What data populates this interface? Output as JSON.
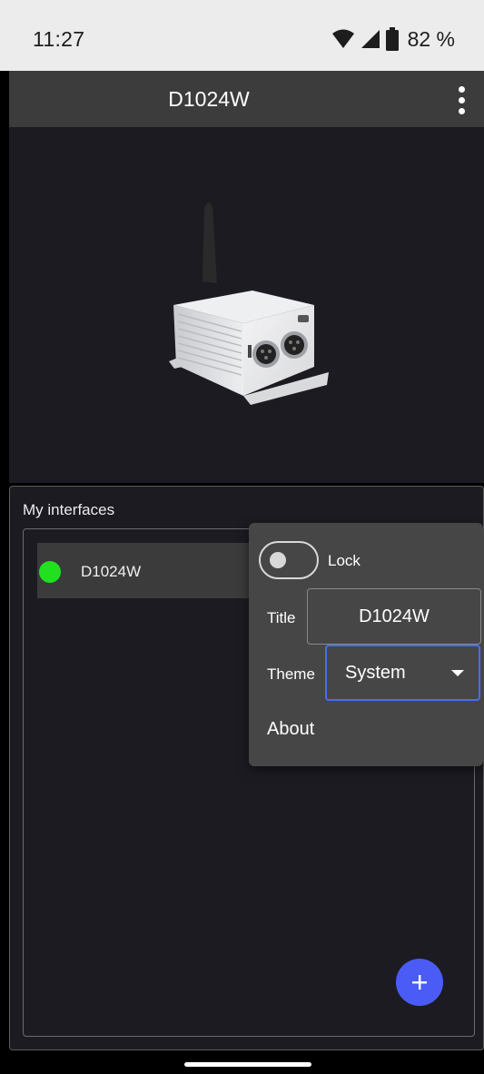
{
  "status_bar": {
    "time": "11:27",
    "battery_percent": "82 %",
    "icons": [
      "wifi-icon",
      "signal-icon",
      "battery-icon"
    ]
  },
  "app_bar": {
    "title": "D1024W",
    "overflow_icon": "more-vert-icon"
  },
  "interfaces": {
    "label": "My interfaces",
    "items": [
      {
        "name": "D1024W",
        "status_color": "#20e020"
      }
    ],
    "add_icon": "plus-icon"
  },
  "menu": {
    "lock_label": "Lock",
    "lock_on": false,
    "title_label": "Title",
    "title_value": "D1024W",
    "theme_label": "Theme",
    "theme_value": "System",
    "about_label": "About"
  },
  "colors": {
    "accent": "#4a5cf5",
    "status_online": "#20e020"
  }
}
